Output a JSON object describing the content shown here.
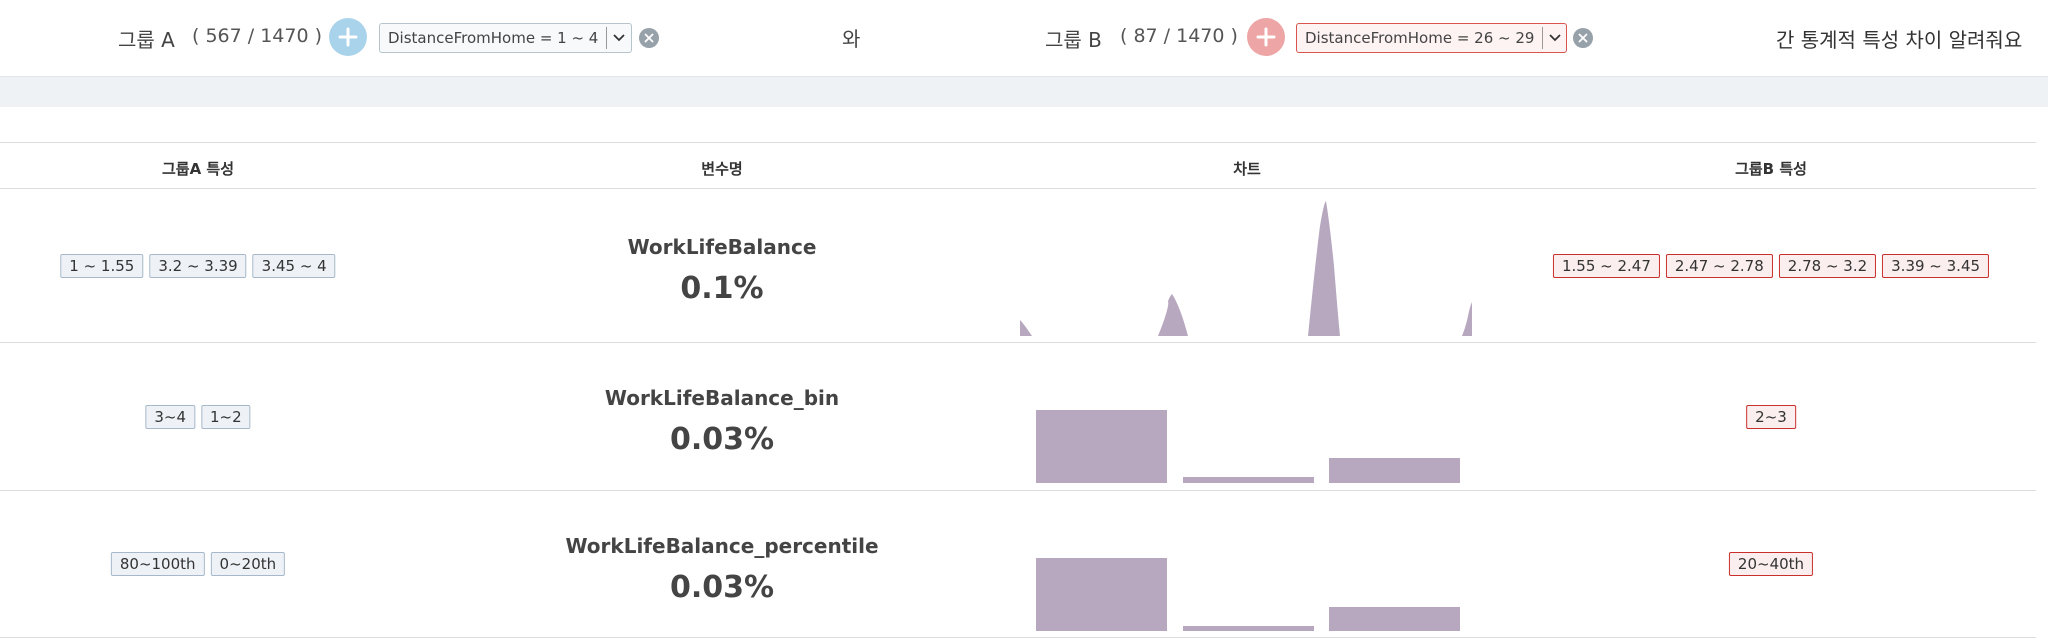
{
  "header": {
    "group_a": {
      "label": "그룹 A",
      "count": "( 567 / 1470 )",
      "filter": "DistanceFromHome = 1 ~ 4"
    },
    "conjunction": "와",
    "group_b": {
      "label": "그룹 B",
      "count": "( 87 / 1470 )",
      "filter": "DistanceFromHome = 26 ~ 29"
    },
    "question": "간 통계적 특성 차이 알려줘요"
  },
  "table": {
    "columns": [
      "그룹A 특성",
      "변수명",
      "차트",
      "그룹B 특성"
    ],
    "rows": [
      {
        "a_tags": [
          "1 ~ 1.55",
          "3.2 ~ 3.39",
          "3.45 ~ 4"
        ],
        "name": "WorkLifeBalance",
        "pct": "0.1%",
        "b_tags": [
          "1.55 ~ 2.47",
          "2.47 ~ 2.78",
          "2.78 ~ 3.2",
          "3.39 ~ 3.45"
        ]
      },
      {
        "a_tags": [
          "3~4",
          "1~2"
        ],
        "name": "WorkLifeBalance_bin",
        "pct": "0.03%",
        "b_tags": [
          "2~3"
        ]
      },
      {
        "a_tags": [
          "80~100th",
          "0~20th"
        ],
        "name": "WorkLifeBalance_percentile",
        "pct": "0.03%",
        "b_tags": [
          "20~40th"
        ]
      }
    ]
  },
  "colors": {
    "chart_fill": "#b7a8bf",
    "group_a_accent": "#a9d3ea",
    "group_b_accent": "#eea5a5"
  },
  "icons": {
    "add": "plus-icon",
    "dropdown": "chevron-down-icon",
    "clear": "close-icon"
  }
}
